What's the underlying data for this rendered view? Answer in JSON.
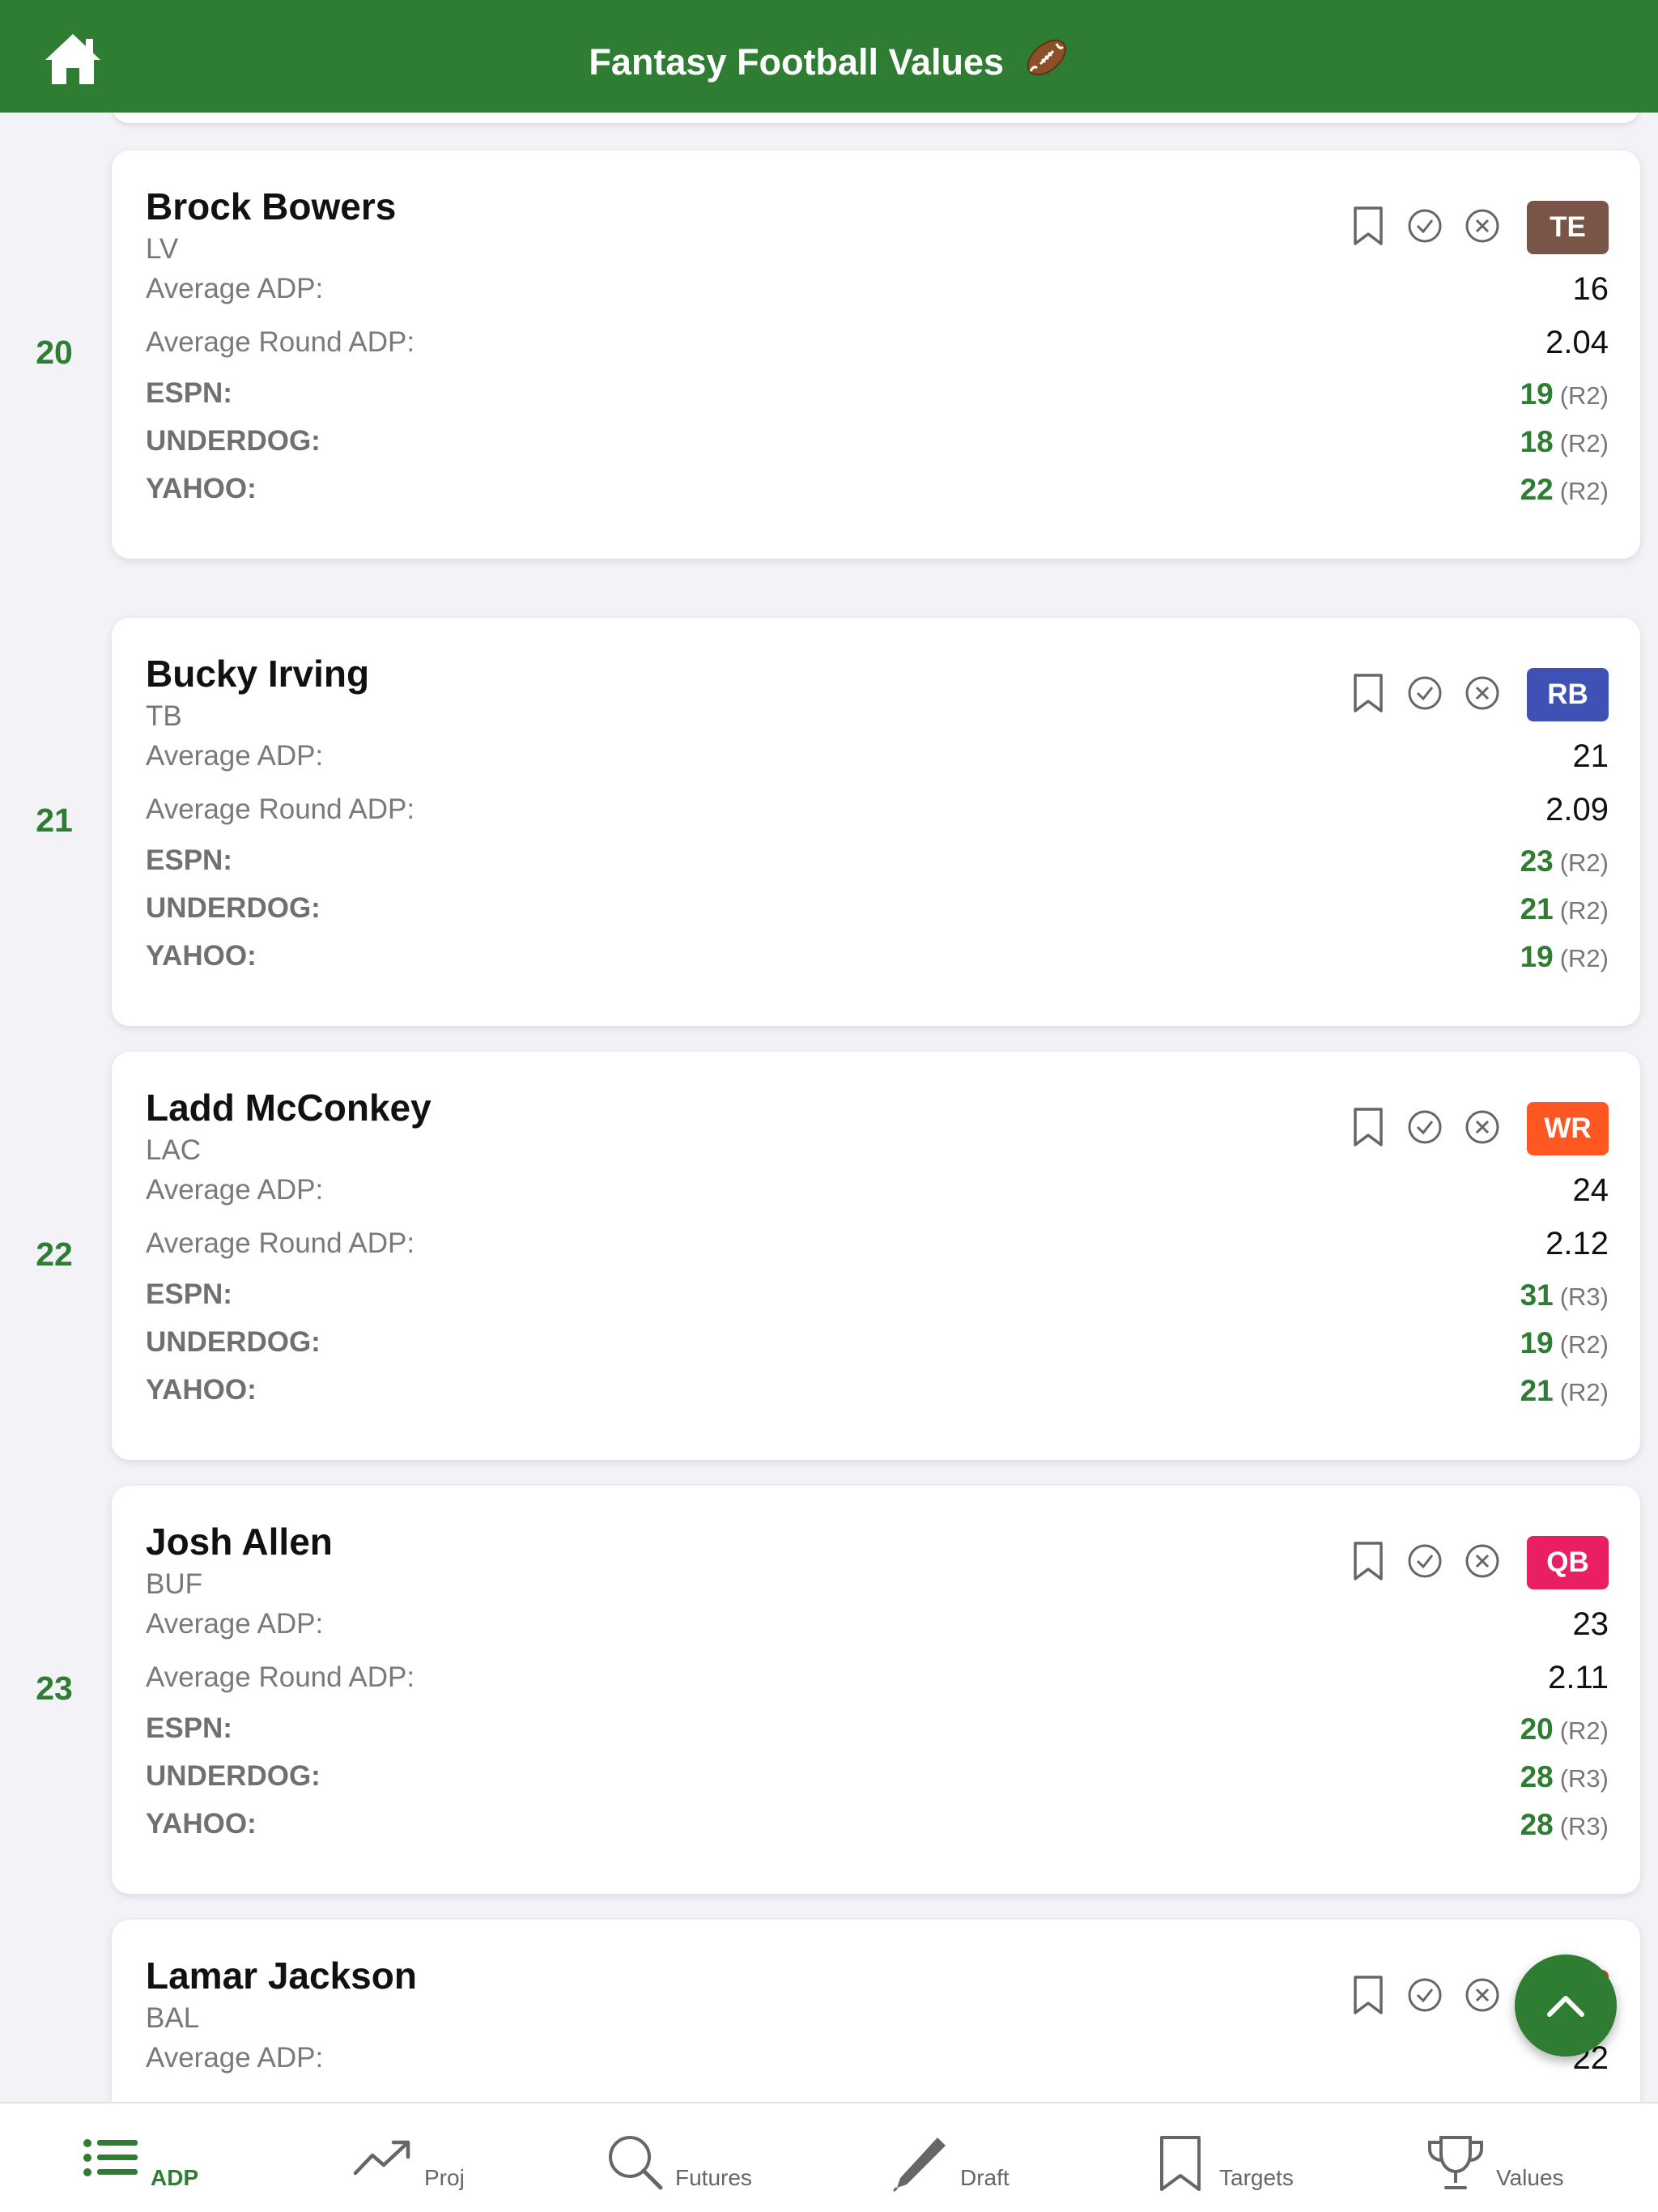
{
  "header": {
    "title": "Fantasy Football Values"
  },
  "icons": {
    "home": "home-icon",
    "football": "football-icon",
    "bookmark": "bookmark-icon",
    "check": "check-circle-icon",
    "remove": "x-circle-icon",
    "fab": "chevron-up-icon"
  },
  "colors": {
    "accent": "#2e7d32",
    "TE": "#795548",
    "RB": "#3f51b5",
    "WR": "#ff5722",
    "QB": "#e91e63"
  },
  "labels": {
    "avg_adp": "Average ADP:",
    "avg_round_adp": "Average Round ADP:",
    "espn": "ESPN:",
    "underdog": "UNDERDOG:",
    "yahoo": "YAHOO:"
  },
  "players": [
    {
      "rank": "20",
      "name": "Brock Bowers",
      "team": "LV",
      "position": "TE",
      "avg_adp": "16",
      "avg_round_adp": "2.04",
      "espn": {
        "pick": "19",
        "round": "(R2)"
      },
      "underdog": {
        "pick": "18",
        "round": "(R2)"
      },
      "yahoo": {
        "pick": "22",
        "round": "(R2)"
      }
    },
    {
      "rank": "21",
      "name": "Bucky Irving",
      "team": "TB",
      "position": "RB",
      "avg_adp": "21",
      "avg_round_adp": "2.09",
      "espn": {
        "pick": "23",
        "round": "(R2)"
      },
      "underdog": {
        "pick": "21",
        "round": "(R2)"
      },
      "yahoo": {
        "pick": "19",
        "round": "(R2)"
      }
    },
    {
      "rank": "22",
      "name": "Ladd McConkey",
      "team": "LAC",
      "position": "WR",
      "avg_adp": "24",
      "avg_round_adp": "2.12",
      "espn": {
        "pick": "31",
        "round": "(R3)"
      },
      "underdog": {
        "pick": "19",
        "round": "(R2)"
      },
      "yahoo": {
        "pick": "21",
        "round": "(R2)"
      }
    },
    {
      "rank": "23",
      "name": "Josh Allen",
      "team": "BUF",
      "position": "QB",
      "avg_adp": "23",
      "avg_round_adp": "2.11",
      "espn": {
        "pick": "20",
        "round": "(R2)"
      },
      "underdog": {
        "pick": "28",
        "round": "(R3)"
      },
      "yahoo": {
        "pick": "28",
        "round": "(R3)"
      }
    },
    {
      "name": "Lamar Jackson",
      "team": "BAL",
      "avg_adp": "22"
    }
  ],
  "tabs": [
    {
      "label": "ADP",
      "icon": "list-icon",
      "active": true
    },
    {
      "label": "Proj",
      "icon": "trending-up-icon"
    },
    {
      "label": "Futures",
      "icon": "search-icon"
    },
    {
      "label": "Draft",
      "icon": "pencil-icon"
    },
    {
      "label": "Targets",
      "icon": "bookmark-icon"
    },
    {
      "label": "Values",
      "icon": "trophy-icon"
    }
  ]
}
